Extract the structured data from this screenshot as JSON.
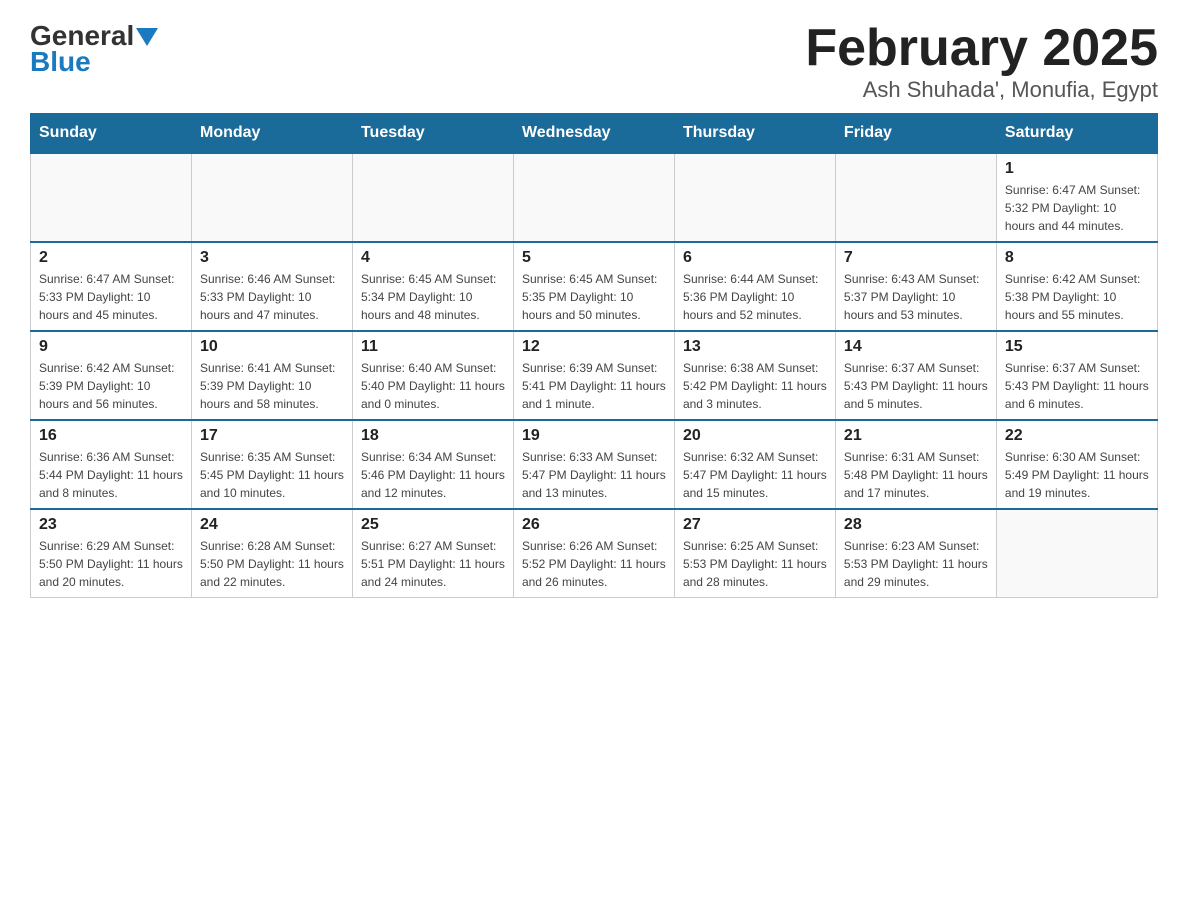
{
  "logo": {
    "general": "General",
    "blue": "Blue"
  },
  "header": {
    "title": "February 2025",
    "subtitle": "Ash Shuhada', Monufia, Egypt"
  },
  "weekdays": [
    "Sunday",
    "Monday",
    "Tuesday",
    "Wednesday",
    "Thursday",
    "Friday",
    "Saturday"
  ],
  "weeks": [
    [
      {
        "day": "",
        "info": ""
      },
      {
        "day": "",
        "info": ""
      },
      {
        "day": "",
        "info": ""
      },
      {
        "day": "",
        "info": ""
      },
      {
        "day": "",
        "info": ""
      },
      {
        "day": "",
        "info": ""
      },
      {
        "day": "1",
        "info": "Sunrise: 6:47 AM\nSunset: 5:32 PM\nDaylight: 10 hours and 44 minutes."
      }
    ],
    [
      {
        "day": "2",
        "info": "Sunrise: 6:47 AM\nSunset: 5:33 PM\nDaylight: 10 hours and 45 minutes."
      },
      {
        "day": "3",
        "info": "Sunrise: 6:46 AM\nSunset: 5:33 PM\nDaylight: 10 hours and 47 minutes."
      },
      {
        "day": "4",
        "info": "Sunrise: 6:45 AM\nSunset: 5:34 PM\nDaylight: 10 hours and 48 minutes."
      },
      {
        "day": "5",
        "info": "Sunrise: 6:45 AM\nSunset: 5:35 PM\nDaylight: 10 hours and 50 minutes."
      },
      {
        "day": "6",
        "info": "Sunrise: 6:44 AM\nSunset: 5:36 PM\nDaylight: 10 hours and 52 minutes."
      },
      {
        "day": "7",
        "info": "Sunrise: 6:43 AM\nSunset: 5:37 PM\nDaylight: 10 hours and 53 minutes."
      },
      {
        "day": "8",
        "info": "Sunrise: 6:42 AM\nSunset: 5:38 PM\nDaylight: 10 hours and 55 minutes."
      }
    ],
    [
      {
        "day": "9",
        "info": "Sunrise: 6:42 AM\nSunset: 5:39 PM\nDaylight: 10 hours and 56 minutes."
      },
      {
        "day": "10",
        "info": "Sunrise: 6:41 AM\nSunset: 5:39 PM\nDaylight: 10 hours and 58 minutes."
      },
      {
        "day": "11",
        "info": "Sunrise: 6:40 AM\nSunset: 5:40 PM\nDaylight: 11 hours and 0 minutes."
      },
      {
        "day": "12",
        "info": "Sunrise: 6:39 AM\nSunset: 5:41 PM\nDaylight: 11 hours and 1 minute."
      },
      {
        "day": "13",
        "info": "Sunrise: 6:38 AM\nSunset: 5:42 PM\nDaylight: 11 hours and 3 minutes."
      },
      {
        "day": "14",
        "info": "Sunrise: 6:37 AM\nSunset: 5:43 PM\nDaylight: 11 hours and 5 minutes."
      },
      {
        "day": "15",
        "info": "Sunrise: 6:37 AM\nSunset: 5:43 PM\nDaylight: 11 hours and 6 minutes."
      }
    ],
    [
      {
        "day": "16",
        "info": "Sunrise: 6:36 AM\nSunset: 5:44 PM\nDaylight: 11 hours and 8 minutes."
      },
      {
        "day": "17",
        "info": "Sunrise: 6:35 AM\nSunset: 5:45 PM\nDaylight: 11 hours and 10 minutes."
      },
      {
        "day": "18",
        "info": "Sunrise: 6:34 AM\nSunset: 5:46 PM\nDaylight: 11 hours and 12 minutes."
      },
      {
        "day": "19",
        "info": "Sunrise: 6:33 AM\nSunset: 5:47 PM\nDaylight: 11 hours and 13 minutes."
      },
      {
        "day": "20",
        "info": "Sunrise: 6:32 AM\nSunset: 5:47 PM\nDaylight: 11 hours and 15 minutes."
      },
      {
        "day": "21",
        "info": "Sunrise: 6:31 AM\nSunset: 5:48 PM\nDaylight: 11 hours and 17 minutes."
      },
      {
        "day": "22",
        "info": "Sunrise: 6:30 AM\nSunset: 5:49 PM\nDaylight: 11 hours and 19 minutes."
      }
    ],
    [
      {
        "day": "23",
        "info": "Sunrise: 6:29 AM\nSunset: 5:50 PM\nDaylight: 11 hours and 20 minutes."
      },
      {
        "day": "24",
        "info": "Sunrise: 6:28 AM\nSunset: 5:50 PM\nDaylight: 11 hours and 22 minutes."
      },
      {
        "day": "25",
        "info": "Sunrise: 6:27 AM\nSunset: 5:51 PM\nDaylight: 11 hours and 24 minutes."
      },
      {
        "day": "26",
        "info": "Sunrise: 6:26 AM\nSunset: 5:52 PM\nDaylight: 11 hours and 26 minutes."
      },
      {
        "day": "27",
        "info": "Sunrise: 6:25 AM\nSunset: 5:53 PM\nDaylight: 11 hours and 28 minutes."
      },
      {
        "day": "28",
        "info": "Sunrise: 6:23 AM\nSunset: 5:53 PM\nDaylight: 11 hours and 29 minutes."
      },
      {
        "day": "",
        "info": ""
      }
    ]
  ]
}
